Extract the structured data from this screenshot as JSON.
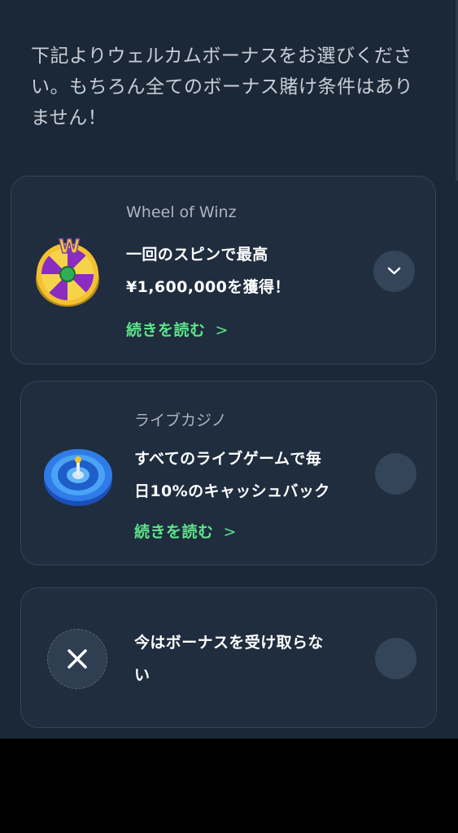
{
  "intro_text": "下記よりウェルカムボーナスをお選びください。もちろん全てのボーナス賭け条件はありません！",
  "bonuses": [
    {
      "category": "Wheel of Winz",
      "title_line1": "一回のスピンで最高",
      "title_line2": "¥1,600,000を獲得！",
      "read_more": "続きを読む",
      "read_more_chevron": ">",
      "icon": "wheel-of-winz-icon",
      "selector": "expand-chevron-down"
    },
    {
      "category": "ライブカジノ",
      "title_line1": "すべてのライブゲームで毎",
      "title_line2": "日10%のキャッシュバック",
      "read_more": "続きを読む",
      "read_more_chevron": ">",
      "icon": "roulette-wheel-icon",
      "selector": "radio-unselected"
    },
    {
      "title_line1": "今はボーナスを受け取らな",
      "title_line2": "い",
      "icon": "close-icon",
      "selector": "radio-unselected"
    }
  ],
  "colors": {
    "background": "#1b2838",
    "card": "#1f2d3e",
    "card_border": "#34455a",
    "accent_green": "#5ee58a",
    "text_primary": "#ffffff",
    "text_secondary": "#aeb5bf"
  }
}
